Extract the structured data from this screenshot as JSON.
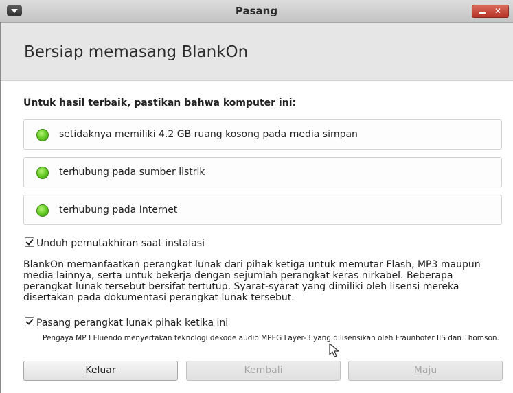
{
  "window": {
    "title": "Pasang"
  },
  "header": {
    "heading": "Bersiap memasang BlankOn"
  },
  "requirements": {
    "heading": "Untuk hasil terbaik, pastikan bahwa komputer ini:",
    "items": [
      {
        "label": "setidaknya memiliki 4.2 GB ruang kosong pada media simpan",
        "status": "ok"
      },
      {
        "label": "terhubung pada sumber listrik",
        "status": "ok"
      },
      {
        "label": "terhubung pada Internet",
        "status": "ok"
      }
    ]
  },
  "options": {
    "download_updates": {
      "label": "Unduh pemutakhiran saat instalasi",
      "checked": true
    },
    "third_party_desc": "BlankOn memanfaatkan perangkat lunak dari pihak ketiga untuk memutar Flash, MP3 maupun media lainnya, serta untuk bekerja dengan sejumlah perangkat keras nirkabel. Beberapa perangkat lunak tersebut bersifat tertutup. Syarat-syarat yang dimiliki oleh lisensi mereka disertakan pada dokumentasi perangkat lunak tersebut.",
    "install_third_party": {
      "label": "Pasang perangkat lunak pihak ketika ini",
      "checked": true
    },
    "mp3_note": "Pengaya MP3 Fluendo menyertakan teknologi dekode audio MPEG Layer-3 yang dilisensikan oleh Fraunhofer IIS dan Thomson."
  },
  "buttons": {
    "quit": {
      "mnemonic": "K",
      "rest": "eluar"
    },
    "back": {
      "before": "Kem",
      "mnemonic": "b",
      "after": "ali",
      "enabled": false
    },
    "forward": {
      "mnemonic": "M",
      "rest": "aju",
      "enabled": false
    }
  },
  "colors": {
    "ok_led": "#6bd02a",
    "close_button": "#c9473a"
  }
}
